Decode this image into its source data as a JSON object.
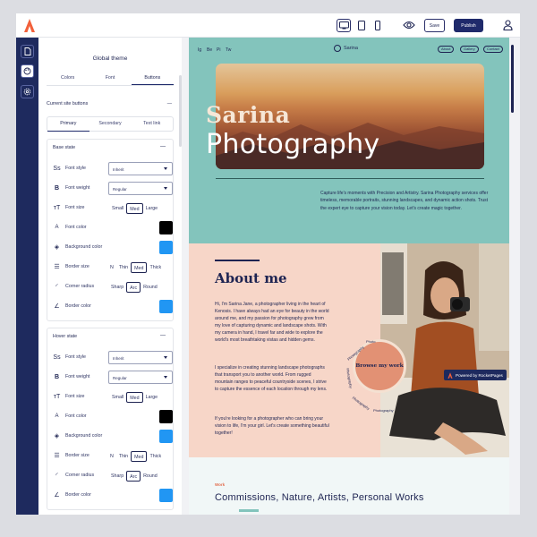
{
  "topbar": {
    "save_label": "Save",
    "publish_label": "Publish"
  },
  "panel": {
    "title": "Global theme",
    "tabs": [
      {
        "label": "Colors"
      },
      {
        "label": "Font"
      },
      {
        "label": "Buttons"
      }
    ],
    "section_title": "Current site buttons",
    "subtabs": [
      {
        "label": "Primary"
      },
      {
        "label": "Secondary"
      },
      {
        "label": "Text link"
      }
    ],
    "base": {
      "title": "Base state",
      "font_style_label": "Font style",
      "font_style_value": "Inherit",
      "font_weight_label": "Font weight",
      "font_weight_value": "Regular",
      "font_size_label": "Font size",
      "font_size_options": [
        "Small",
        "Med",
        "Large"
      ],
      "font_size_selected": "Med",
      "font_color_label": "Font color",
      "font_color": "#000000",
      "bg_color_label": "Background color",
      "bg_color": "#2196f3",
      "border_size_label": "Border size",
      "border_size_options": [
        "N",
        "Thin",
        "Med",
        "Thick"
      ],
      "border_size_selected": "Med",
      "corner_radius_label": "Corner radius",
      "corner_radius_options": [
        "Sharp",
        "Arc",
        "Round"
      ],
      "corner_radius_selected": "Arc",
      "border_color_label": "Border color",
      "border_color": "#2196f3"
    },
    "hover": {
      "title": "Hover state",
      "font_style_label": "Font style",
      "font_style_value": "Inherit",
      "font_weight_label": "Font weight",
      "font_weight_value": "Regular",
      "font_size_label": "Font size",
      "font_size_options": [
        "Small",
        "Med",
        "Large"
      ],
      "font_size_selected": "Med",
      "font_color_label": "Font color",
      "font_color": "#000000",
      "bg_color_label": "Background color",
      "bg_color": "#2196f3",
      "border_size_label": "Border size",
      "border_size_options": [
        "N",
        "Thin",
        "Med",
        "Thick"
      ],
      "border_size_selected": "Med",
      "corner_radius_label": "Corner radius",
      "corner_radius_options": [
        "Sharp",
        "Arc",
        "Round"
      ],
      "corner_radius_selected": "Arc",
      "border_color_label": "Border color",
      "border_color": "#2196f3"
    }
  },
  "preview": {
    "social": [
      "Ig",
      "Be",
      "Pi",
      "Tw"
    ],
    "brand": "Sarina",
    "nav": [
      "About",
      "Gallery",
      "Contact"
    ],
    "hero_title_1": "Sarina",
    "hero_title_2": "Photography",
    "hero_text": "Capture life's moments with Precision and Artistry. Sarina Photography services offer timeless, memorable portraits, stunning landscapes, and dynamic action shots. Trust the expert eye to capture your vision today. Let's create magic together.",
    "about_title": "About me",
    "about_p1": "Hi, I'm Sarina Jane, a photographer living in the heart of Kenosis. I have always had an eye for beauty in the world around me, and my passion for photography grew from my love of capturing dynamic and landscape shots. With my camera in hand, I travel far and wide to explore the world's most breathtaking vistas and hidden gems.",
    "about_p2": "I specialize in creating stunning landscape photographs that transport you to another world. From rugged mountain ranges to peaceful countryside scenes, I strive to capture the essence of each location through my lens.",
    "about_p3": "If you're looking for a photographer who can bring your vision to life, I'm your girl. Let's create something beautiful together!",
    "circle_text": "Browse my work",
    "ring_texts": [
      "Photography",
      "Photography",
      "Photography",
      "Photography",
      "Photo"
    ],
    "powered": "Powered by RocketPages",
    "works_tag": "Work",
    "works_title": "Commissions,  Nature,  Artists,  Personal Works"
  },
  "colors": {
    "navy": "#1e2a5e",
    "teal": "#83c4bc",
    "peach": "#f7d6c8",
    "accent": "#e29174",
    "blue": "#2196f3"
  },
  "icons": [
    "rocket-logo-icon",
    "desktop-icon",
    "tablet-icon",
    "mobile-icon",
    "eye-icon",
    "user-icon",
    "pages-icon",
    "theme-icon",
    "settings-icon"
  ]
}
